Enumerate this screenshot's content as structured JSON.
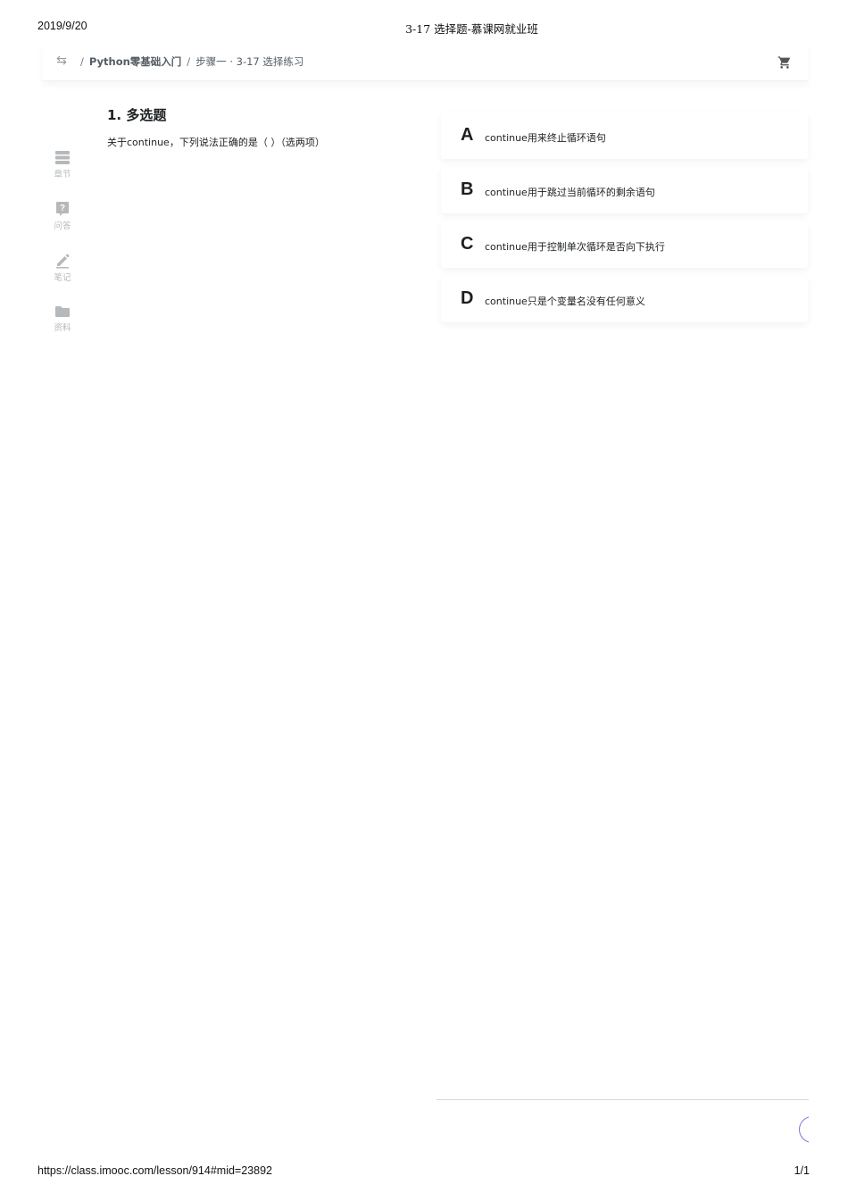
{
  "print_header": {
    "date": "2019/9/20",
    "title": "3-17 选择题-慕课网就业班"
  },
  "print_footer": {
    "url": "https://class.imooc.com/lesson/914#mid=23892",
    "page": "1/1"
  },
  "topbar": {
    "separator": "/",
    "course_label": "Python零基础入门",
    "lesson_label": "步骤一 · 3-17 选择练习",
    "back_icon": "back-arrows-icon",
    "cart_icon": "cart-icon"
  },
  "sidebar": {
    "items": [
      {
        "label": "章节",
        "icon": "chapter-icon"
      },
      {
        "label": "问答",
        "icon": "question-icon"
      },
      {
        "label": "笔记",
        "icon": "pencil-icon"
      },
      {
        "label": "资料",
        "icon": "folder-icon"
      }
    ]
  },
  "question": {
    "title": "1. 多选题",
    "text": "关于continue，下列说法正确的是（ ）（选两项）"
  },
  "options": [
    {
      "letter": "A",
      "text": "continue用来终止循环语句"
    },
    {
      "letter": "B",
      "text": "continue用于跳过当前循环的剩余语句"
    },
    {
      "letter": "C",
      "text": "continue用于控制单次循环是否向下执行"
    },
    {
      "letter": "D",
      "text": "continue只是个变量名没有任何意义"
    }
  ],
  "colors": {
    "accent": "#8a6fd8",
    "text": "#1c1f21",
    "muted": "#b5b9bc"
  }
}
